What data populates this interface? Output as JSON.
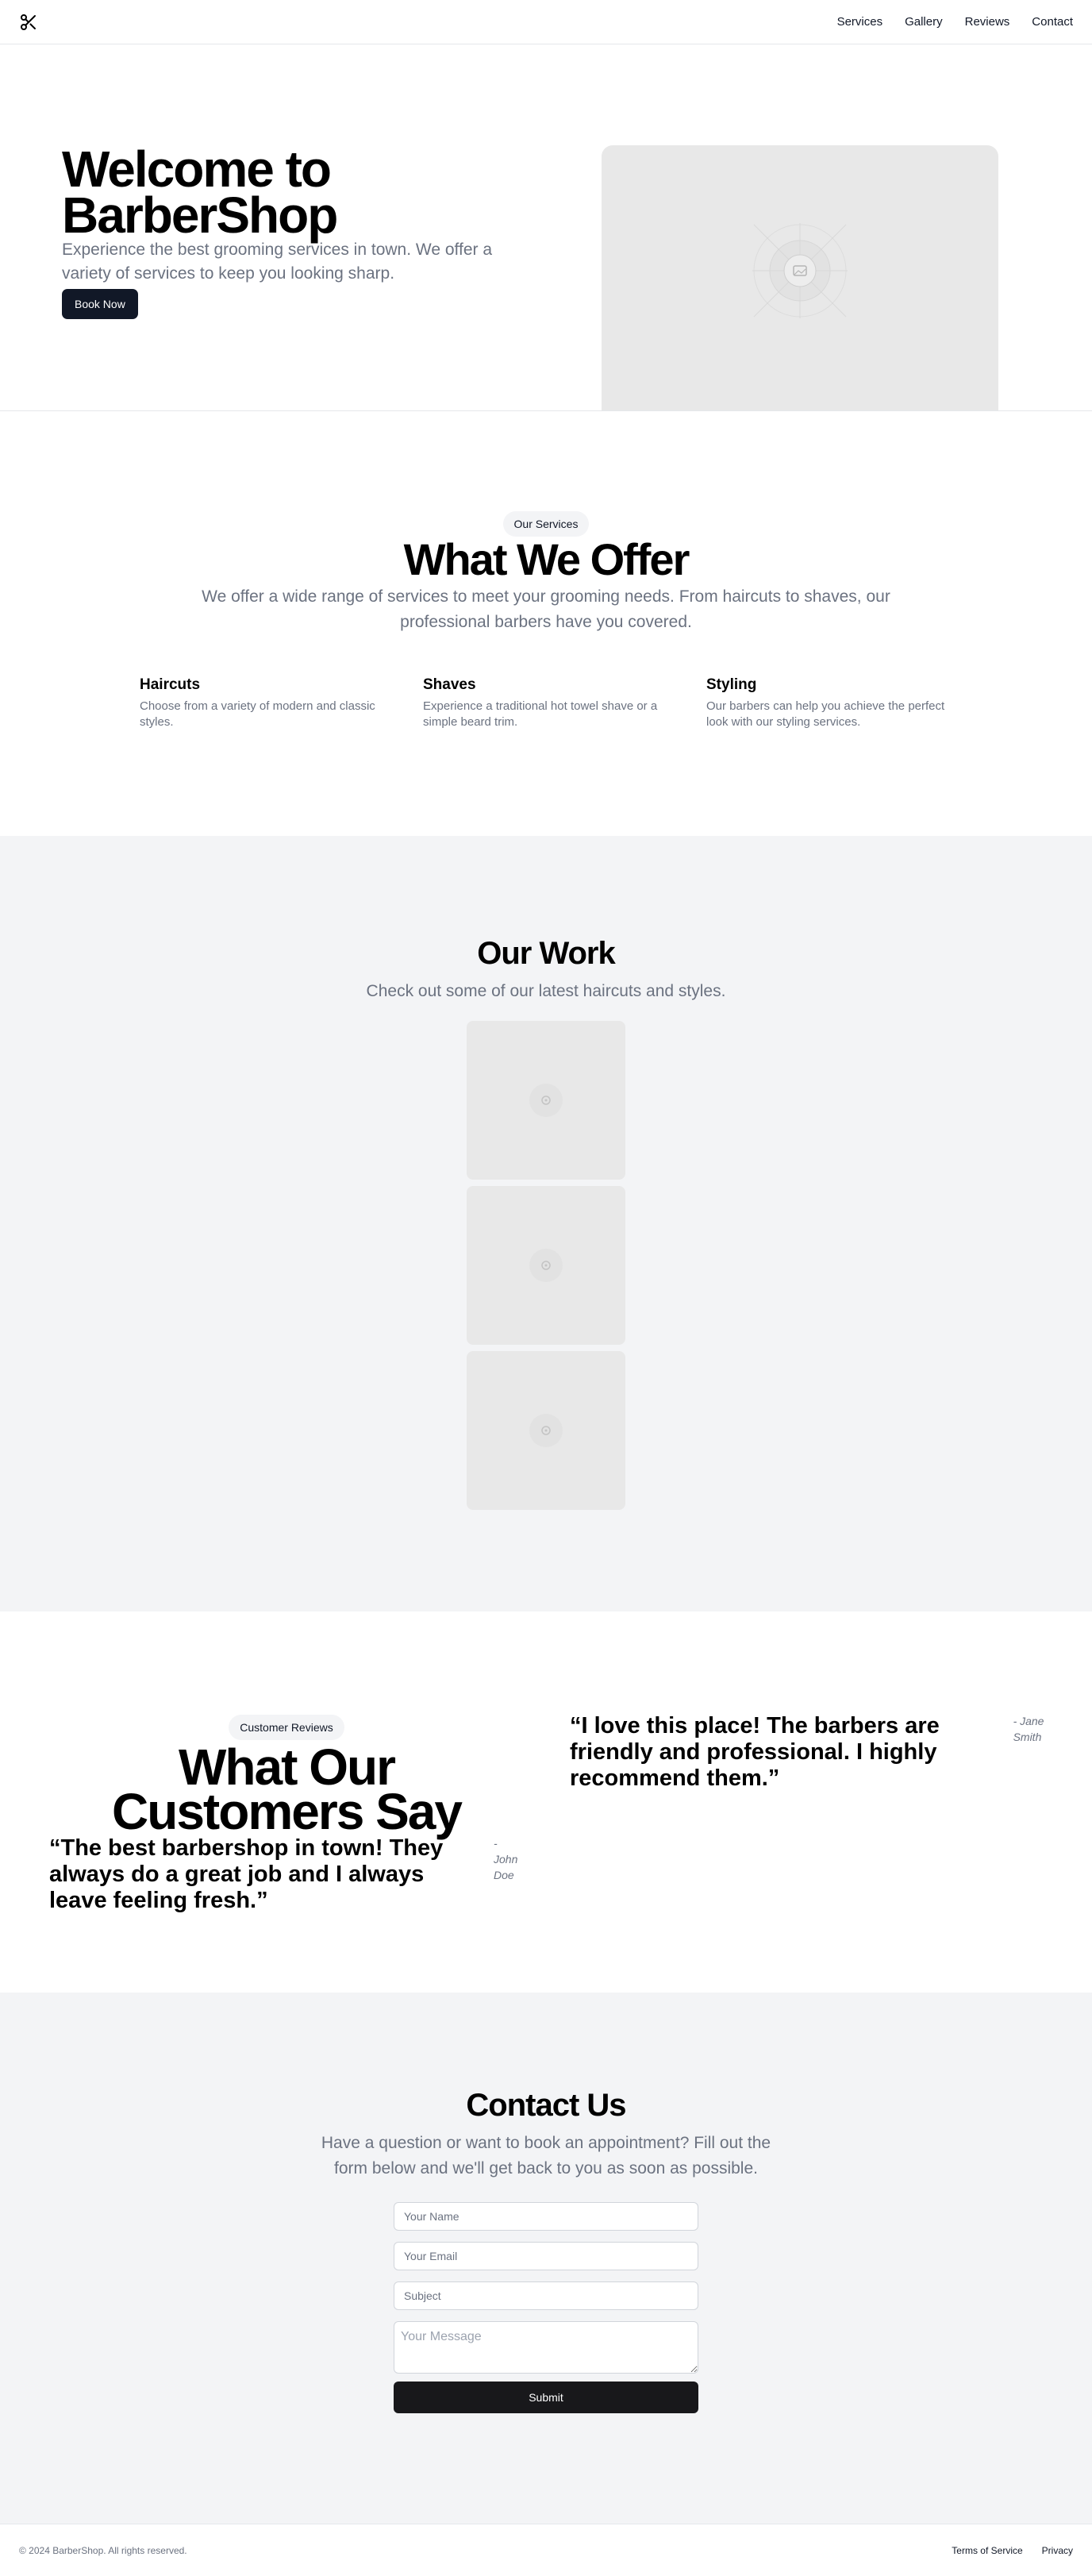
{
  "header": {
    "logo_icon": "scissors-icon",
    "nav": [
      "Services",
      "Gallery",
      "Reviews",
      "Contact"
    ]
  },
  "hero": {
    "title": "Welcome to BarberShop",
    "subtitle": "Experience the best grooming services in town. We offer a variety of services to keep you looking sharp.",
    "cta_label": "Book Now",
    "image_icon": "image-placeholder-icon"
  },
  "services": {
    "badge": "Our Services",
    "title": "What We Offer",
    "subtitle": "We offer a wide range of services to meet your grooming needs. From haircuts to shaves, our professional barbers have you covered.",
    "items": [
      {
        "title": "Haircuts",
        "description": "Choose from a variety of modern and classic styles."
      },
      {
        "title": "Shaves",
        "description": "Experience a traditional hot towel shave or a simple beard trim."
      },
      {
        "title": "Styling",
        "description": "Our barbers can help you achieve the perfect look with our styling services."
      }
    ]
  },
  "gallery": {
    "title": "Our Work",
    "subtitle": "Check out some of our latest haircuts and styles.",
    "image_count": 3,
    "image_icon": "image-placeholder-icon"
  },
  "reviews": {
    "badge": "Customer Reviews",
    "title": "What Our Customers Say",
    "items": [
      {
        "quote": "“The best barbershop in town! They always do a great job and I always leave feeling fresh.”",
        "author": "- John Doe"
      },
      {
        "quote": "“I love this place! The barbers are friendly and professional. I highly recommend them.”",
        "author": "- Jane Smith"
      }
    ]
  },
  "contact": {
    "title": "Contact Us",
    "subtitle": "Have a question or want to book an appointment? Fill out the form below and we'll get back to you as soon as possible.",
    "name_placeholder": "Your Name",
    "email_placeholder": "Your Email",
    "subject_placeholder": "Subject",
    "message_placeholder": "Your Message",
    "submit_label": "Submit"
  },
  "footer": {
    "copyright": "© 2024 BarberShop. All rights reserved.",
    "links": [
      "Terms of Service",
      "Privacy"
    ]
  },
  "colors": {
    "primary_button": "#111827",
    "muted_text": "#6b7280",
    "section_alt_bg": "#f3f4f6",
    "placeholder_bg": "#e8e8e8"
  }
}
